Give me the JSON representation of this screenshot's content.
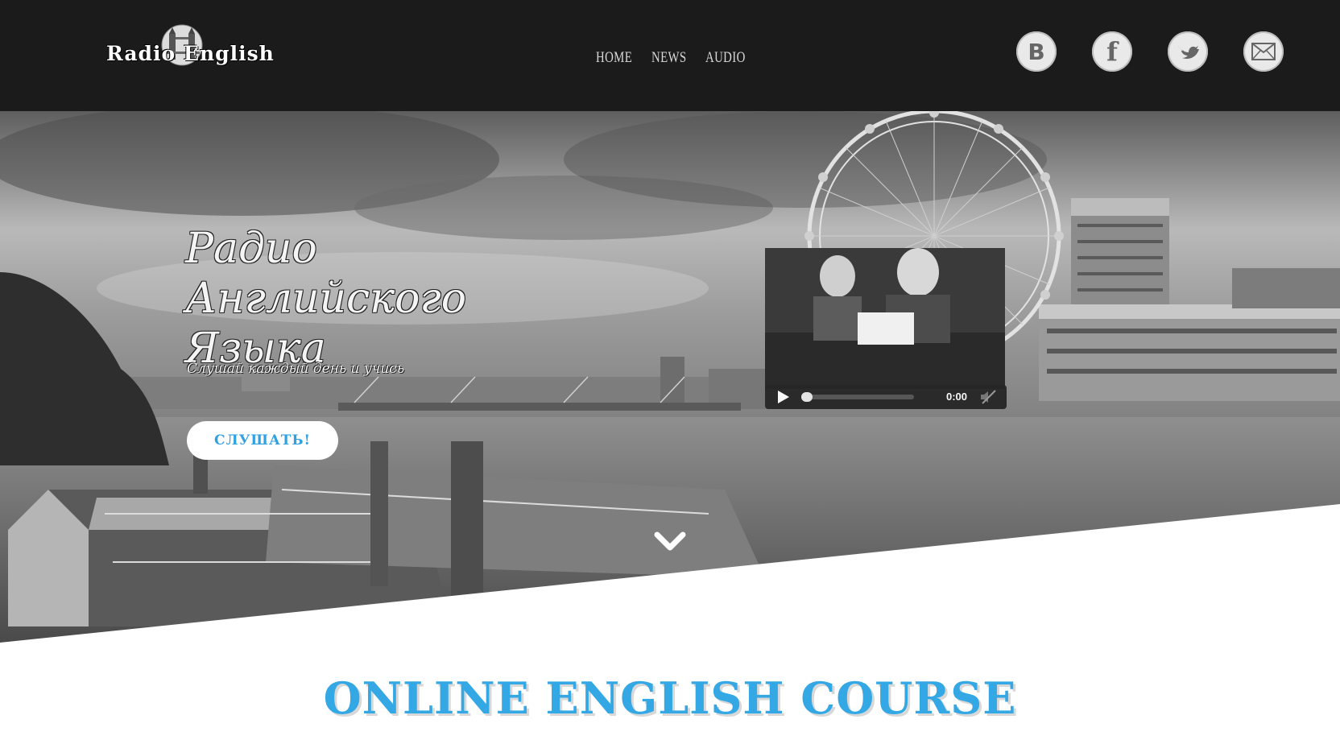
{
  "header": {
    "logo_text": "Radio English",
    "nav": [
      {
        "label": "HOME"
      },
      {
        "label": "NEWS"
      },
      {
        "label": "AUDIO"
      }
    ],
    "social": [
      {
        "icon": "vk-icon",
        "glyph": "B"
      },
      {
        "icon": "facebook-icon",
        "glyph": "f"
      },
      {
        "icon": "twitter-icon",
        "glyph": ""
      },
      {
        "icon": "mail-icon",
        "glyph": ""
      }
    ]
  },
  "hero": {
    "title": "Радио Английского Языка",
    "subtitle": "Слушай каждый день и учись",
    "button_label": "СЛУШАТЬ!",
    "player": {
      "time": "0:00",
      "progress": 0
    }
  },
  "course": {
    "title": "ONLINE ENGLISH COURSE"
  },
  "colors": {
    "header_bg": "#1b1b1b",
    "accent": "#33a8e4",
    "button_text": "#2fa0e2"
  }
}
